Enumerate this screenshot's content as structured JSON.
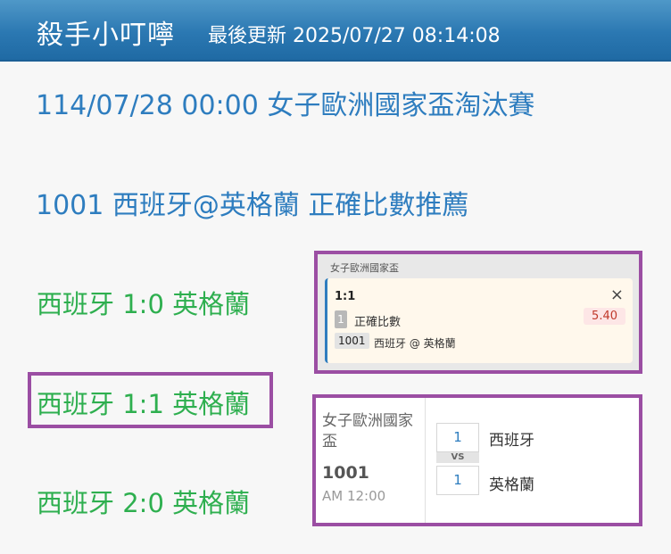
{
  "header": {
    "title": "殺手小叮嚀",
    "updated": "最後更新 2025/07/27 08:14:08"
  },
  "main": {
    "match_heading": "114/07/28 00:00 女子歐洲國家盃淘汰賽",
    "pick_heading": "1001 西班牙@英格蘭 正確比數推薦",
    "scores": [
      "西班牙 1:0 英格蘭",
      "西班牙 1:1 英格蘭",
      "西班牙 2:0 英格蘭"
    ]
  },
  "betslip": {
    "league": "女子歐洲國家盃",
    "selection": "1:1",
    "close_icon": "×",
    "number_badge": "1",
    "market": "正確比數",
    "odds": "5.40",
    "code": "1001",
    "match": "西班牙 @ 英格蘭"
  },
  "match_card": {
    "league": "女子歐洲國家盃",
    "code": "1001",
    "time": "AM 12:00",
    "home_box": "1",
    "away_box": "1",
    "vs": "VS",
    "home_team": "西班牙",
    "away_team": "英格蘭"
  },
  "colors": {
    "header": "#2b78b2",
    "heading_blue": "#2e7dbf",
    "score_green": "#2eaf4f",
    "highlight_purple": "#9b4ea3",
    "odds_red": "#c0392b"
  }
}
